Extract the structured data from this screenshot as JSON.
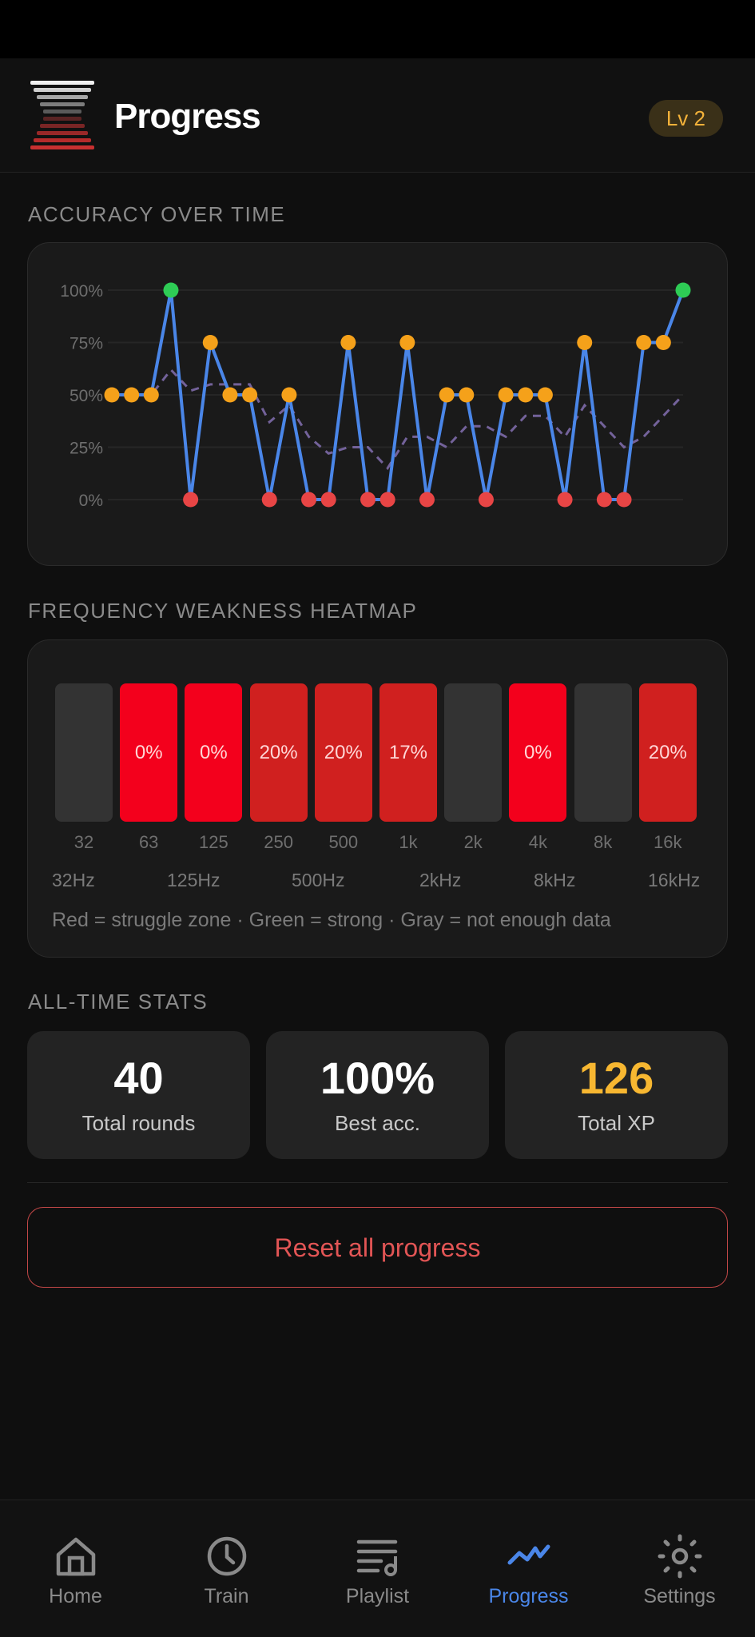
{
  "header": {
    "title": "Progress",
    "level_badge": "Lv 2"
  },
  "sections": {
    "accuracy_title": "ACCURACY OVER TIME",
    "heatmap_title": "FREQUENCY WEAKNESS HEATMAP",
    "stats_title": "ALL-TIME STATS"
  },
  "chart_data": {
    "type": "line",
    "title": "",
    "y_ticks": [
      "100%",
      "75%",
      "50%",
      "25%",
      "0%"
    ],
    "ylim": [
      0,
      100
    ],
    "grid": true,
    "series": [
      {
        "role": "per-round accuracy",
        "color": "#4a86e8",
        "values": [
          50,
          50,
          50,
          100,
          0,
          75,
          50,
          50,
          0,
          50,
          0,
          0,
          75,
          0,
          0,
          75,
          0,
          50,
          50,
          0,
          50,
          50,
          50,
          0,
          75,
          0,
          0,
          75,
          75,
          100
        ]
      },
      {
        "role": "moving average",
        "color": "#7d6aa8",
        "style": "dashed",
        "values": [
          50,
          50,
          50,
          62,
          52,
          55,
          55,
          55,
          37,
          45,
          30,
          22,
          25,
          25,
          15,
          30,
          30,
          25,
          35,
          35,
          30,
          40,
          40,
          30,
          45,
          35,
          25,
          30,
          40,
          50
        ]
      }
    ],
    "point_colors": {
      "high": "#2ecc55",
      "mid": "#f5a11a",
      "low": "#e84545"
    }
  },
  "heatmap": {
    "bands": [
      {
        "label": "32",
        "value": "",
        "state": "none"
      },
      {
        "label": "63",
        "value": "0%",
        "state": "bright"
      },
      {
        "label": "125",
        "value": "0%",
        "state": "bright"
      },
      {
        "label": "250",
        "value": "20%",
        "state": "dark"
      },
      {
        "label": "500",
        "value": "20%",
        "state": "dark"
      },
      {
        "label": "1k",
        "value": "17%",
        "state": "dark"
      },
      {
        "label": "2k",
        "value": "",
        "state": "none"
      },
      {
        "label": "4k",
        "value": "0%",
        "state": "bright"
      },
      {
        "label": "8k",
        "value": "",
        "state": "none"
      },
      {
        "label": "16k",
        "value": "20%",
        "state": "dark"
      }
    ],
    "colors": {
      "bright": "#f3001c",
      "dark": "#d0201f",
      "none": "#333333"
    },
    "hz_labels": [
      "32Hz",
      "125Hz",
      "500Hz",
      "2kHz",
      "8kHz",
      "16kHz"
    ],
    "legend": "Red = struggle zone · Green = strong · Gray = not enough data"
  },
  "stats": [
    {
      "value": "40",
      "label": "Total rounds",
      "color": "#ffffff"
    },
    {
      "value": "100%",
      "label": "Best acc.",
      "color": "#ffffff"
    },
    {
      "value": "126",
      "label": "Total XP",
      "color": "#f7b731"
    }
  ],
  "reset_label": "Reset all progress",
  "nav": [
    {
      "label": "Home",
      "icon": "home-icon",
      "active": false
    },
    {
      "label": "Train",
      "icon": "clock-icon",
      "active": false
    },
    {
      "label": "Playlist",
      "icon": "playlist-icon",
      "active": false
    },
    {
      "label": "Progress",
      "icon": "trend-icon",
      "active": true
    },
    {
      "label": "Settings",
      "icon": "gear-icon",
      "active": false
    }
  ]
}
